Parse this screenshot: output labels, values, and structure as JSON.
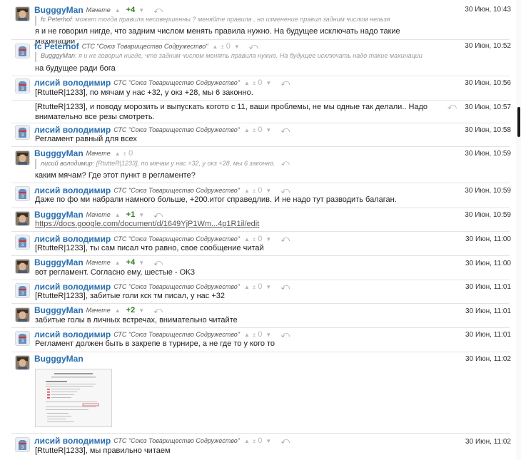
{
  "messages": [
    {
      "author": "BugggyMan",
      "team": "Мачете",
      "score": "+4",
      "time": "30 Июн, 10:43",
      "quote_author": "fc Peterhof",
      "quote_text": "может тогда правила несовершенны ? меняйте правила , но изменение правил задним числом нельзя",
      "text": "я и не говорил нигде, что задним числом менять правила нужно. На будущее исключать надо такие махинации"
    },
    {
      "author": "fc Peterhof",
      "team": "СТС \"Союз Товарищество Содружество\"",
      "score": "0",
      "time": "30 Июн, 10:52",
      "quote_author": "BugggyMan",
      "quote_text": "я и не говорил нигде, что задним числом менять правила нужно. На будущее исключать надо такие махинации",
      "text": "на будущее ради бога"
    },
    {
      "author": "лисий володимир",
      "team": "СТС \"Союз Товарищество Содружество\"",
      "score": "0",
      "time": "30 Июн, 10:56",
      "text": "[RtutteR|1233], по мячам у нас +32, у окз +28, мы 6 законно."
    },
    {
      "time": "30 Июн, 10:57",
      "text": "[RtutteR|1233], и поводу морозить и выпускать когото с 11, ваши проблемы, не мы одные так делали.. Надо внимательно все резы смотреть."
    },
    {
      "author": "лисий володимир",
      "team": "СТС \"Союз Товарищество Содружество\"",
      "score": "0",
      "time": "30 Июн, 10:58",
      "text": "Регламент равный для всех"
    },
    {
      "author": "BugggyMan",
      "team": "Мачете",
      "score": "0",
      "time": "30 Июн, 10:59",
      "quote_author": "лисий володимир",
      "quote_text": "[RtutteR|1233], по мячам у нас +32, у окз +28, мы 6 законно.",
      "text": "каким мячам? Где этот пункт в регламенте?"
    },
    {
      "author": "лисий володимир",
      "team": "СТС \"Союз Товарищество Содружество\"",
      "score": "0",
      "time": "30 Июн, 10:59",
      "text": "Даже по фо ми набрали намного больше, +200.итог справедлив. И не надо тут разводить балаган."
    },
    {
      "author": "BugggyMan",
      "team": "Мачете",
      "score": "+1",
      "time": "30 Июн, 10:59",
      "text": "https://docs.google.com/document/d/1649YjP1Wm...4p1R1il/edit"
    },
    {
      "author": "лисий володимир",
      "team": "СТС \"Союз Товарищество Содружество\"",
      "score": "0",
      "time": "30 Июн, 11:00",
      "text": "[RtutteR|1233], ты сам писал что равно, свое сообщение читай"
    },
    {
      "author": "BugggyMan",
      "team": "Мачете",
      "score": "+4",
      "time": "30 Июн, 11:00",
      "text": "вот регламент. Согласно ему, шестые - ОКЗ"
    },
    {
      "author": "лисий володимир",
      "team": "СТС \"Союз Товарищество Содружество\"",
      "score": "0",
      "time": "30 Июн, 11:01",
      "text": "[RtutteR|1233], забитые голи кск тм писал, у нас +32"
    },
    {
      "author": "BugggyMan",
      "team": "Мачете",
      "score": "+2",
      "time": "30 Июн, 11:01",
      "text": "забитые голы в личных встречах, внимательно читайте"
    },
    {
      "author": "лисий володимир",
      "team": "СТС \"Союз Товарищество Содружество\"",
      "score": "0",
      "time": "30 Июн, 11:01",
      "text": "Регламент должен быть в закрепе в турнире, а не где то у кого то"
    },
    {
      "author": "BugggyMan",
      "time": "30 Июн, 11:02"
    },
    {
      "author": "лисий володимир",
      "team": "СТС \"Союз Товарищество Содружество\"",
      "score": "0",
      "time": "30 Июн, 11:02",
      "text": "[RtutteR|1233], мы правильно читаем"
    }
  ],
  "controls": {
    "up": "▲",
    "pm": "±",
    "down": "▼",
    "reply": "⤺"
  },
  "colors": {
    "author": "#2a6fb0",
    "positive_score": "#2e7d1b",
    "muted": "#b5b5b5"
  }
}
